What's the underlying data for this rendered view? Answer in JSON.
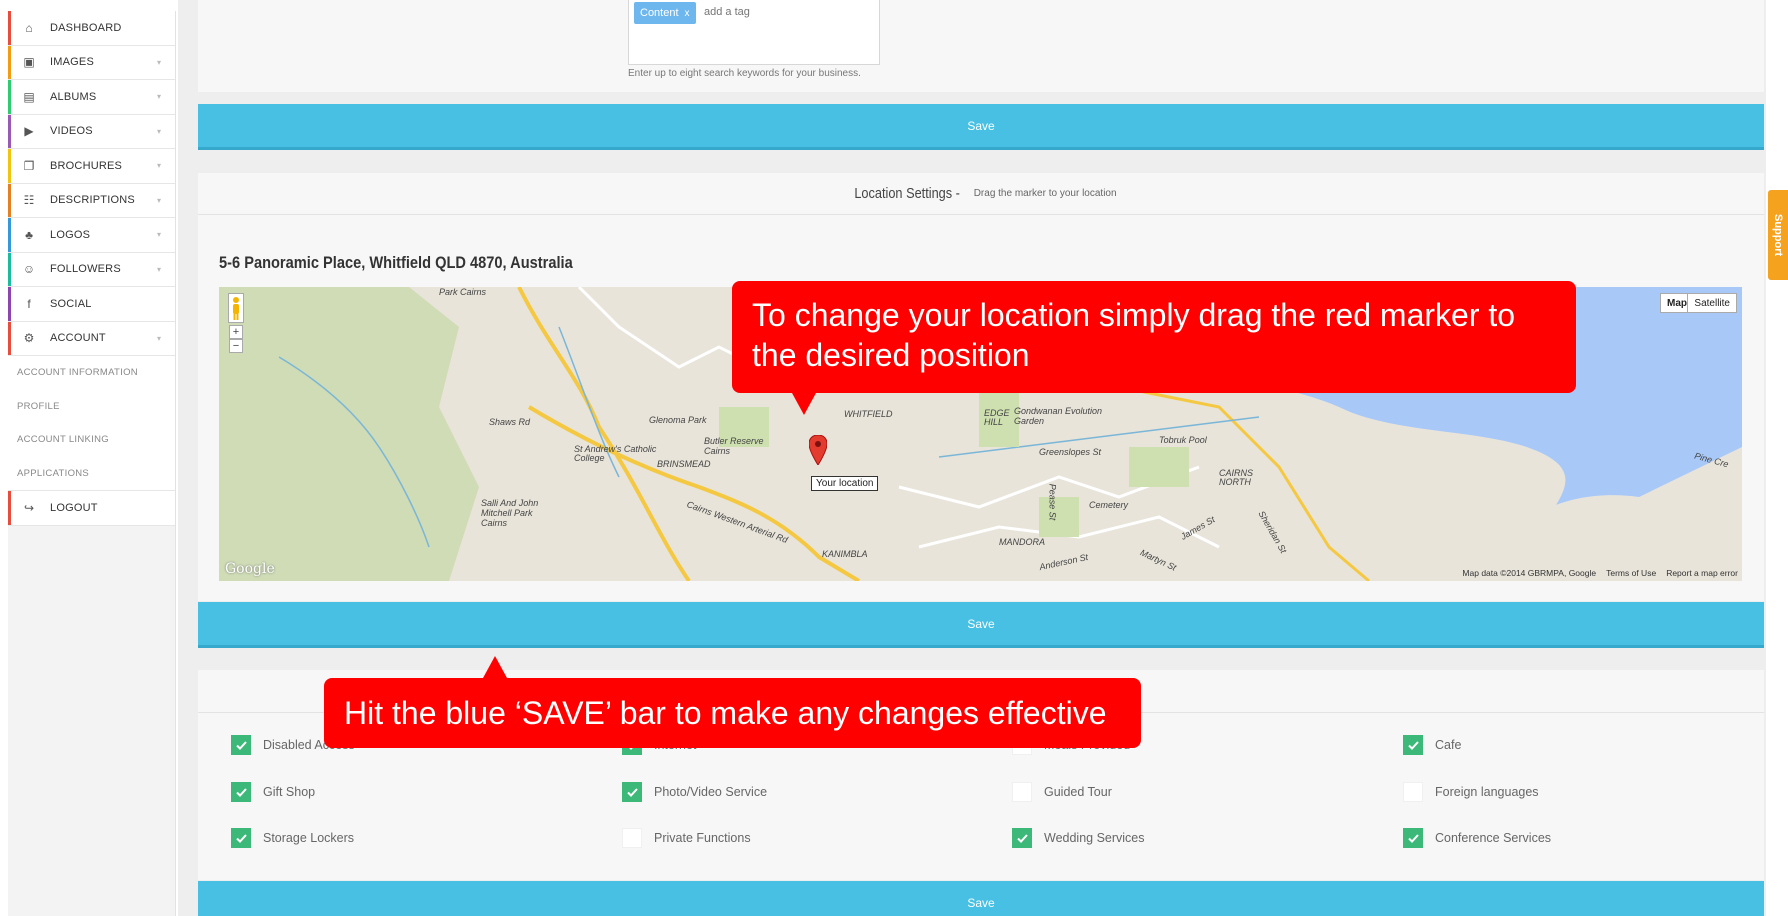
{
  "sidebar": {
    "items": [
      {
        "label": "DASHBOARD",
        "icon": "home-icon",
        "color": "#e74c3c",
        "chevron": false
      },
      {
        "label": "IMAGES",
        "icon": "image-icon",
        "color": "#f39c12",
        "chevron": true
      },
      {
        "label": "ALBUMS",
        "icon": "album-icon",
        "color": "#2ecc71",
        "chevron": true
      },
      {
        "label": "VIDEOS",
        "icon": "video-icon",
        "color": "#9b59b6",
        "chevron": true
      },
      {
        "label": "BROCHURES",
        "icon": "brochure-icon",
        "color": "#f1c40f",
        "chevron": true
      },
      {
        "label": "DESCRIPTIONS",
        "icon": "description-icon",
        "color": "#e67e22",
        "chevron": true
      },
      {
        "label": "LOGOS",
        "icon": "logo-icon",
        "color": "#3498db",
        "chevron": true
      },
      {
        "label": "FOLLOWERS",
        "icon": "followers-icon",
        "color": "#1abc9c",
        "chevron": true
      },
      {
        "label": "SOCIAL",
        "icon": "facebook-icon",
        "color": "#8e44ad",
        "chevron": false
      },
      {
        "label": "ACCOUNT",
        "icon": "gear-icon",
        "color": "#e74c3c",
        "chevron": true
      }
    ],
    "sub_items": [
      "ACCOUNT INFORMATION",
      "PROFILE",
      "ACCOUNT LINKING",
      "APPLICATIONS"
    ],
    "logout": {
      "label": "LOGOUT",
      "icon": "logout-icon",
      "color": "#e74c3c"
    }
  },
  "tags": {
    "chip_label": "Content",
    "chip_remove": "x",
    "placeholder": "add a tag",
    "hint": "Enter up to eight search keywords for your business."
  },
  "save_label": "Save",
  "location": {
    "title": "Location Settings -",
    "subtitle": "Drag the marker to your location",
    "address": "5-6 Panoramic Place, Whitfield QLD 4870, Australia",
    "map_button": "Map",
    "satellite_button": "Satellite",
    "marker_label": "Your location",
    "zoom_in": "+",
    "zoom_out": "−",
    "google_logo": "Google",
    "attribution": "Map data ©2014 GBRMPA, Google",
    "terms": "Terms of Use",
    "report": "Report a map error",
    "places": [
      "Park Cairns",
      "Shaws Rd",
      "Glenoma Park",
      "St Andrew's Catholic College",
      "BRINSMEAD",
      "Butler Reserve Cairns",
      "WHITFIELD",
      "EDGE HILL",
      "Gondwanan Evolution Garden",
      "Tobruk Pool",
      "Greenslopes St",
      "CAIRNS NORTH",
      "Cemetery",
      "MANDORA",
      "KANIMBLA",
      "Salli And John Mitchell Park Cairns",
      "Cairns Western Arterial Rd",
      "Anderson St",
      "Martyn St",
      "James St",
      "Pine Cre",
      "Sheridan St",
      "Pease St"
    ]
  },
  "callouts": {
    "map_tip": "To change your location simply drag the red marker to the desired position",
    "save_tip": "Hit the blue ‘SAVE’ bar to make any changes effective"
  },
  "features": [
    {
      "label": "Disabled Access",
      "checked": true
    },
    {
      "label": "Internet",
      "checked": true
    },
    {
      "label": "Meals Provided",
      "checked": false
    },
    {
      "label": "Cafe",
      "checked": true
    },
    {
      "label": "Gift Shop",
      "checked": true
    },
    {
      "label": "Photo/Video Service",
      "checked": true
    },
    {
      "label": "Guided Tour",
      "checked": false
    },
    {
      "label": "Foreign languages",
      "checked": false
    },
    {
      "label": "Storage Lockers",
      "checked": true
    },
    {
      "label": "Private Functions",
      "checked": false
    },
    {
      "label": "Wedding Services",
      "checked": true
    },
    {
      "label": "Conference Services",
      "checked": true
    }
  ],
  "support_label": "Support",
  "colors": {
    "save_bar": "#47c0e3",
    "callout": "#ff0000",
    "check_on": "#3cb878",
    "support": "#f5a21f"
  }
}
